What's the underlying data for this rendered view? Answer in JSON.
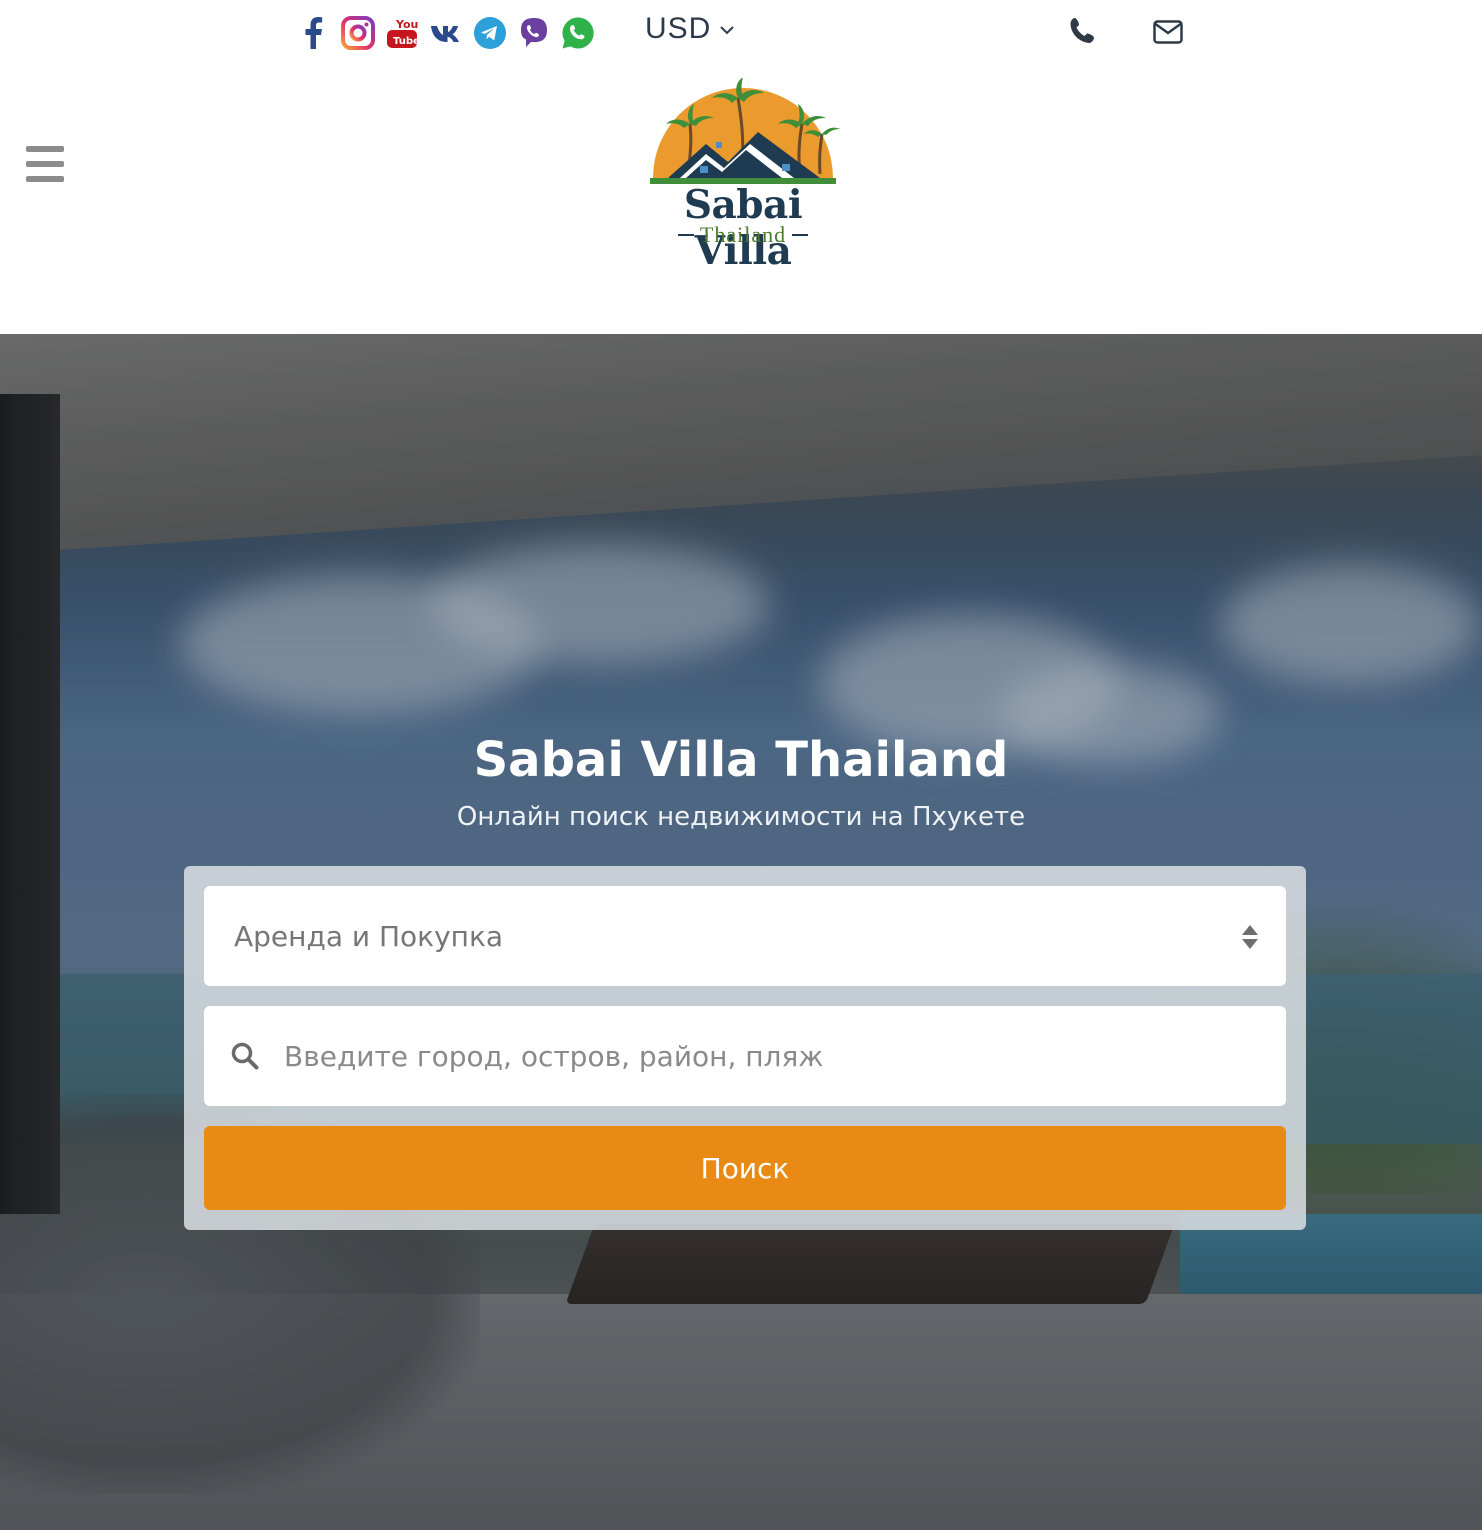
{
  "social": [
    "facebook-icon",
    "instagram-icon",
    "youtube-icon",
    "vk-icon",
    "telegram-icon",
    "viber-icon",
    "whatsapp-icon"
  ],
  "currency": {
    "label": "USD"
  },
  "contacts": [
    "phone-icon",
    "envelope-icon"
  ],
  "logo": {
    "name": "Sabai Villa",
    "tagline": "Thailand"
  },
  "hero": {
    "title": "Sabai Villa Thailand",
    "subtitle": "Онлайн поиск недвижимости на Пхукете"
  },
  "search": {
    "type_value": "Аренда и Покупка",
    "location_placeholder": "Введите город, остров, район, пляж",
    "button_label": "Поиск"
  },
  "colors": {
    "accent": "#e88a14",
    "brand_dark": "#1f3b52",
    "brand_green": "#4a7a2a"
  }
}
